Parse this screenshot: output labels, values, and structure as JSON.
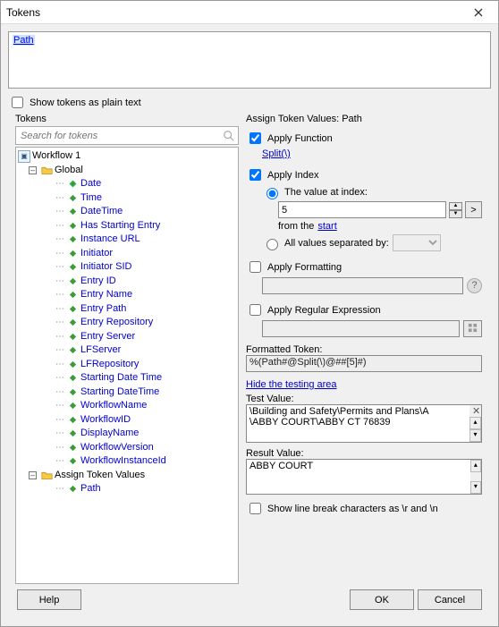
{
  "window": {
    "title": "Tokens"
  },
  "preview": {
    "chip": "Path"
  },
  "plaintext": {
    "label": "Show tokens as plain text",
    "checked": false
  },
  "left": {
    "group_label": "Tokens",
    "search_placeholder": "Search for tokens",
    "root": "Workflow 1",
    "folders": [
      {
        "name": "Global",
        "items": [
          "Date",
          "Time",
          "DateTime",
          "Has Starting Entry",
          "Instance URL",
          "Initiator",
          "Initiator SID",
          "Entry ID",
          "Entry Name",
          "Entry Path",
          "Entry Repository",
          "Entry Server",
          "LFServer",
          "LFRepository",
          "Starting Date Time",
          "Starting DateTime",
          "WorkflowName",
          "WorkflowID",
          "DisplayName",
          "WorkflowVersion",
          "WorkflowInstanceId"
        ]
      },
      {
        "name": "Assign Token Values",
        "items": [
          "Path"
        ]
      }
    ]
  },
  "right": {
    "heading": "Assign Token Values: Path",
    "apply_function": {
      "label": "Apply Function",
      "checked": true,
      "link": "Split(\\)"
    },
    "apply_index": {
      "label": "Apply Index",
      "checked": true,
      "radio_at": {
        "label": "The value at index:",
        "selected": true,
        "value": "5",
        "from_prefix": "from the",
        "from_link": "start"
      },
      "radio_all": {
        "label": "All values separated by:",
        "selected": false
      },
      "gt_btn": ">"
    },
    "apply_formatting": {
      "label": "Apply Formatting",
      "checked": false
    },
    "apply_regex": {
      "label": "Apply Regular Expression",
      "checked": false
    },
    "formatted": {
      "label": "Formatted Token:",
      "value": "%(Path#@Split(\\)@##[5]#)"
    },
    "hide_link": "Hide the testing area",
    "test": {
      "label": "Test Value:",
      "value": "\\Building and Safety\\Permits and Plans\\A\n\\ABBY COURT\\ABBY CT 76839\n"
    },
    "result": {
      "label": "Result Value:",
      "value": "ABBY COURT"
    },
    "linebreak": {
      "label": "Show line break characters as \\r and \\n",
      "checked": false
    }
  },
  "foot": {
    "help": "Help",
    "ok": "OK",
    "cancel": "Cancel"
  }
}
